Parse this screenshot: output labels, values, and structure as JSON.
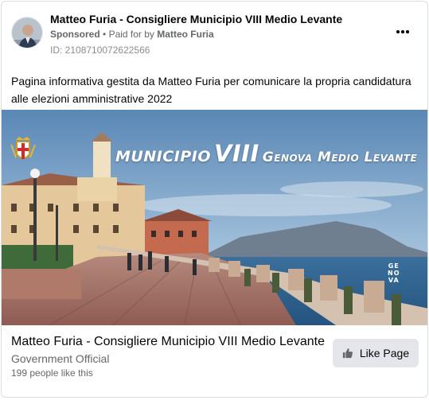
{
  "ad": {
    "page_name": "Matteo Furia - Consigliere Municipio VIII Medio Levante",
    "sponsored_label": "Sponsored",
    "separator": "•",
    "paid_for_by_label": "Paid for by",
    "payer": "Matteo Furia",
    "ad_id": "ID: 2108710072622566",
    "more_icon": "more-options-icon",
    "body_text": "Pagina informativa gestita da Matteo Furia per comunicare la propria candidatura alle elezioni amministrative 2022"
  },
  "media": {
    "banner_word1": "MUNICIPIO",
    "banner_word2": "VIII",
    "banner_word3": "Genova Medio Levante",
    "logo_mark_line1": "GE",
    "logo_mark_line2": "NO",
    "logo_mark_line3": "VA"
  },
  "footer": {
    "title": "Matteo Furia - Consigliere Municipio VIII Medio Levante",
    "category": "Government Official",
    "likes": "199 people like this",
    "like_button_label": "Like Page",
    "like_icon": "thumbs-up-icon"
  },
  "colors": {
    "text_primary": "#050505",
    "text_secondary": "#65676b",
    "button_bg": "#e4e6eb",
    "border": "#dadde1"
  }
}
